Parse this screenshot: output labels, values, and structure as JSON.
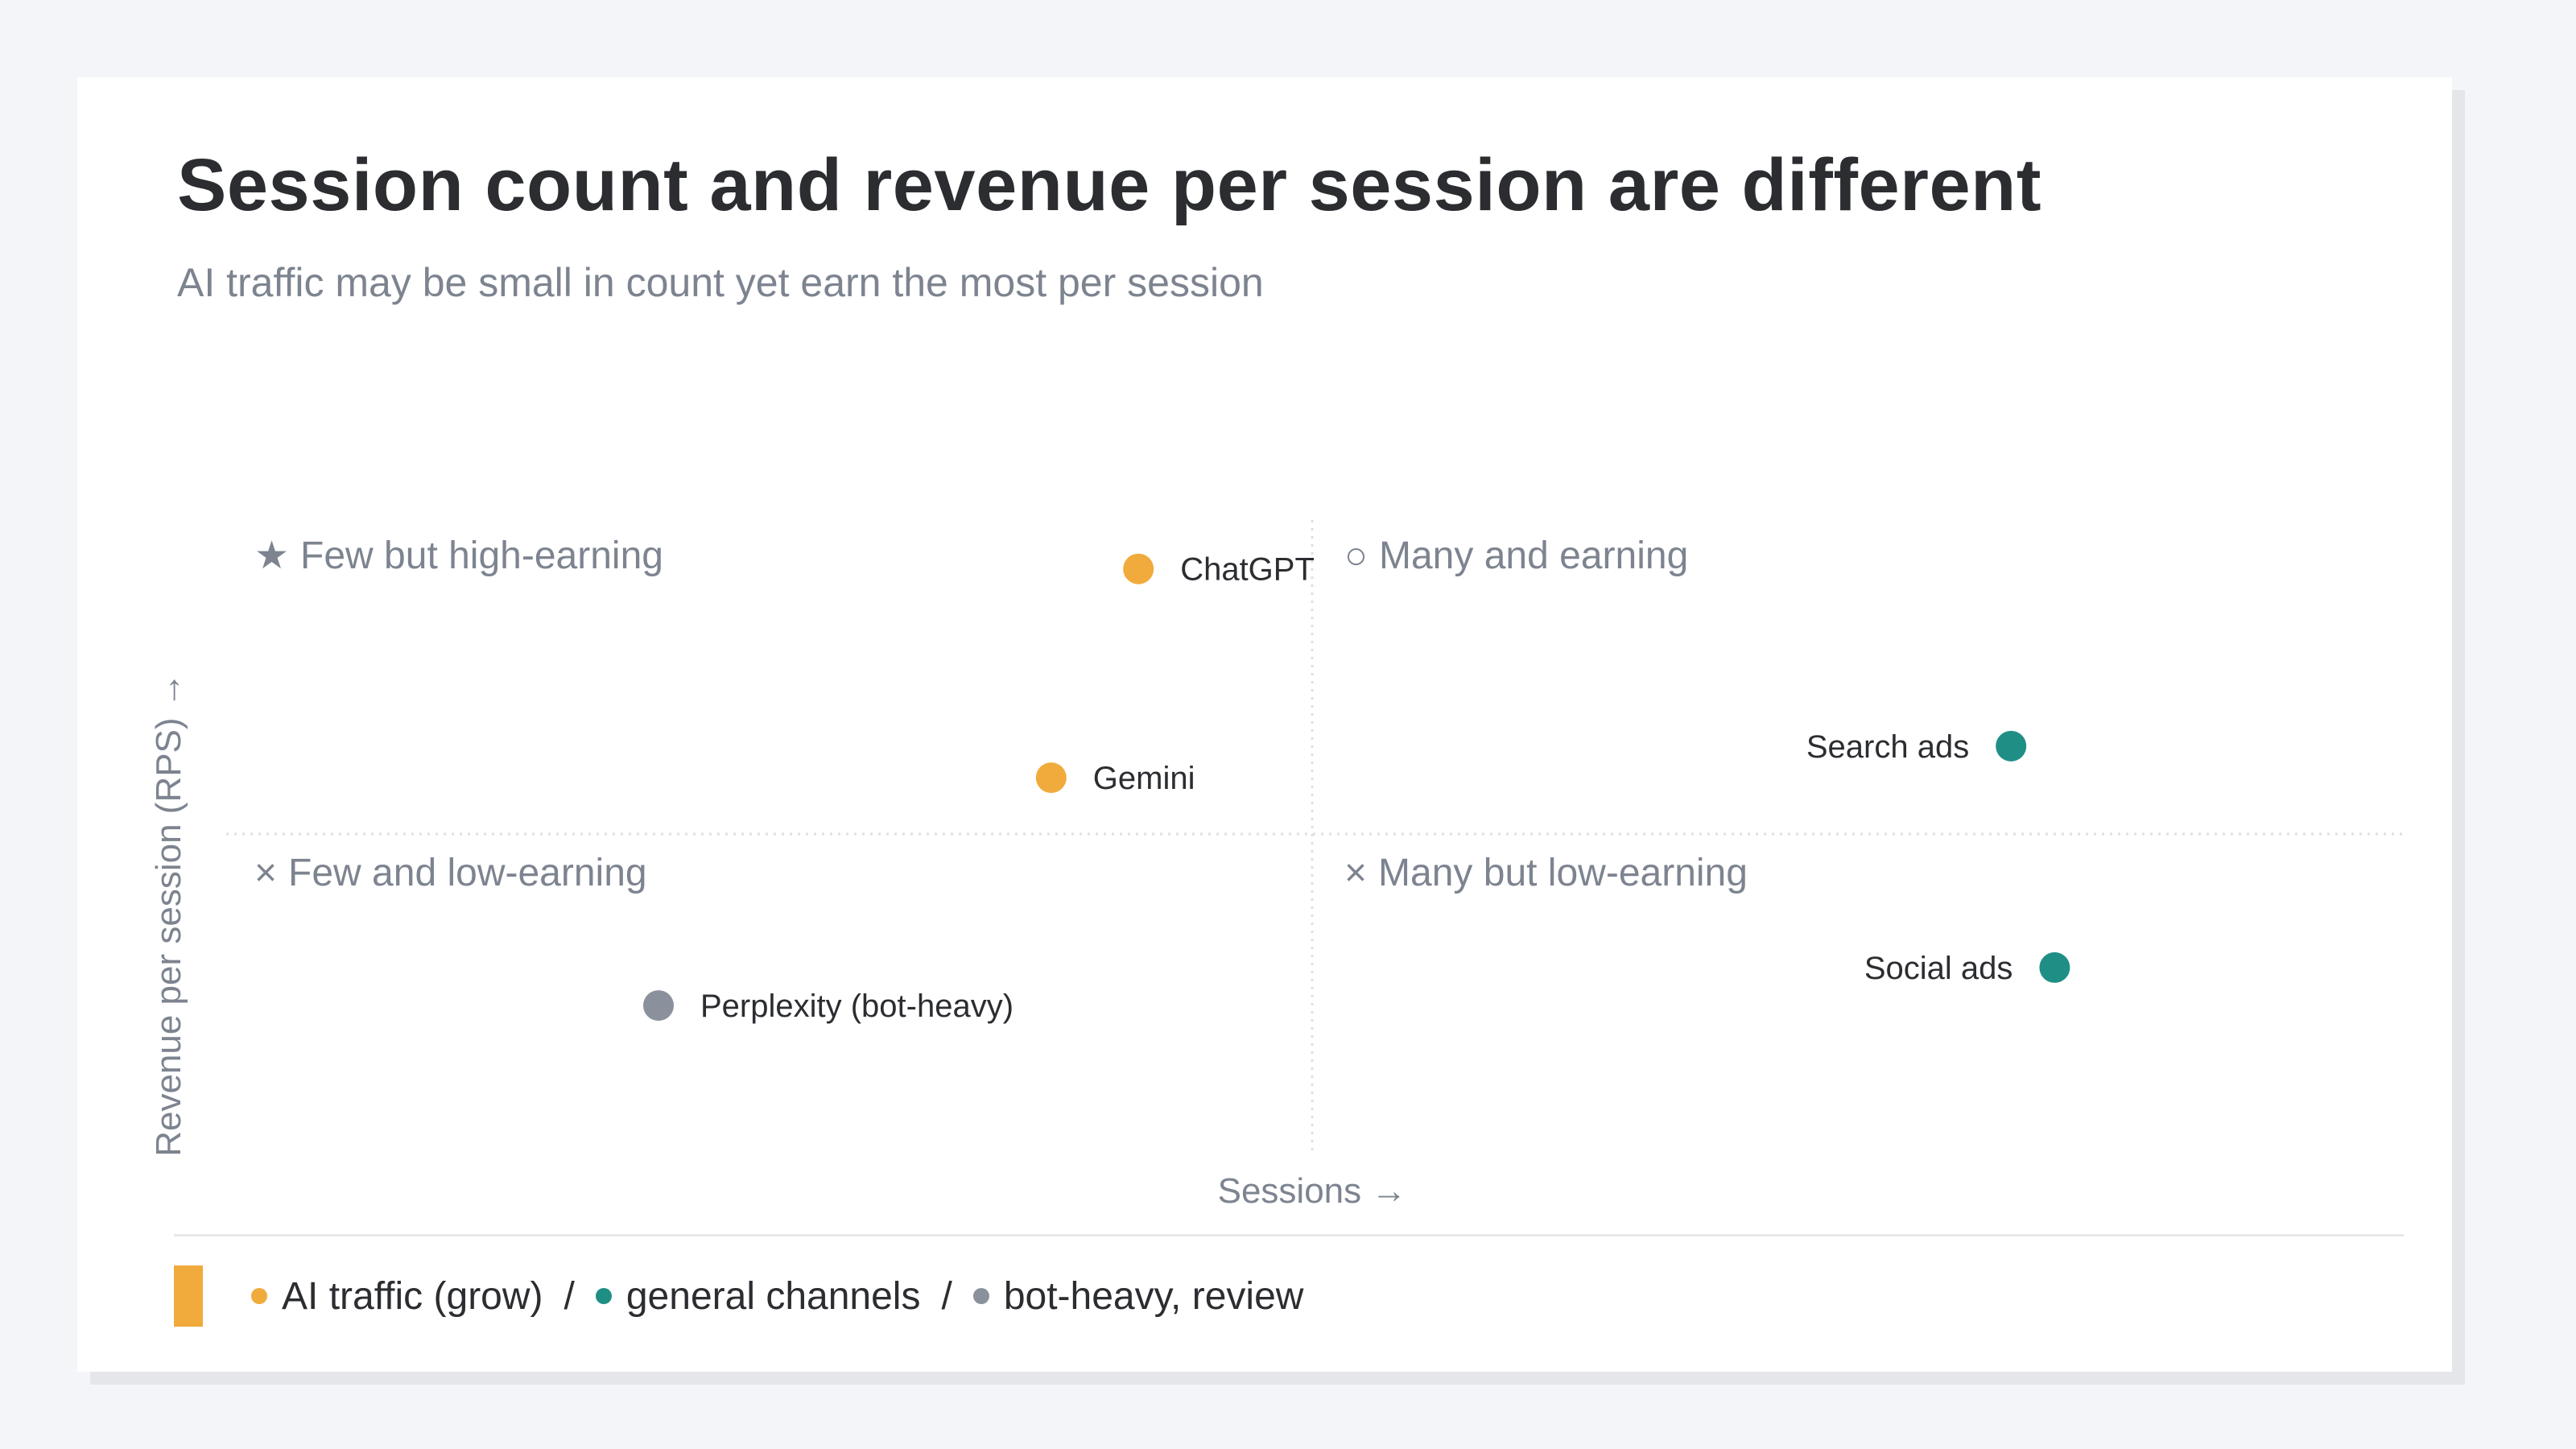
{
  "title": "Session count and revenue per session are different",
  "subtitle": "AI traffic may be small in count yet earn the most per session",
  "colors": {
    "ai": "#f0ab3c",
    "general": "#1f8f86",
    "bot": "#8b919c",
    "muted": "#7d8490",
    "text": "#2b2d31"
  },
  "chart_data": {
    "type": "scatter",
    "xlabel": "Sessions →",
    "ylabel": "Revenue per session (RPS) →",
    "xlim": [
      0,
      100
    ],
    "ylim": [
      0,
      100
    ],
    "grid": false,
    "quadrant_dividers": {
      "x": 50,
      "y": 50
    },
    "quadrants": [
      {
        "id": "top-left",
        "glyph": "★",
        "label": "Few but high-earning"
      },
      {
        "id": "top-right",
        "glyph": "○",
        "label": "Many and earning"
      },
      {
        "id": "bottom-left",
        "glyph": "×",
        "label": "Few and low-earning"
      },
      {
        "id": "bottom-right",
        "glyph": "×",
        "label": "Many but low-earning"
      }
    ],
    "points": [
      {
        "label": "ChatGPT",
        "group": "ai",
        "x": 42,
        "y": 91,
        "label_side": "right"
      },
      {
        "label": "Gemini",
        "group": "ai",
        "x": 38,
        "y": 58,
        "label_side": "right"
      },
      {
        "label": "Perplexity (bot-heavy)",
        "group": "bot",
        "x": 20,
        "y": 22,
        "label_side": "right"
      },
      {
        "label": "Search ads",
        "group": "general",
        "x": 82,
        "y": 63,
        "label_side": "left"
      },
      {
        "label": "Social ads",
        "group": "general",
        "x": 84,
        "y": 28,
        "label_side": "left"
      }
    ]
  },
  "legend": {
    "items": [
      {
        "label": "AI traffic (grow)",
        "group": "ai"
      },
      {
        "label": "general channels",
        "group": "general"
      },
      {
        "label": "bot-heavy, review",
        "group": "bot"
      }
    ],
    "separator": "/"
  }
}
